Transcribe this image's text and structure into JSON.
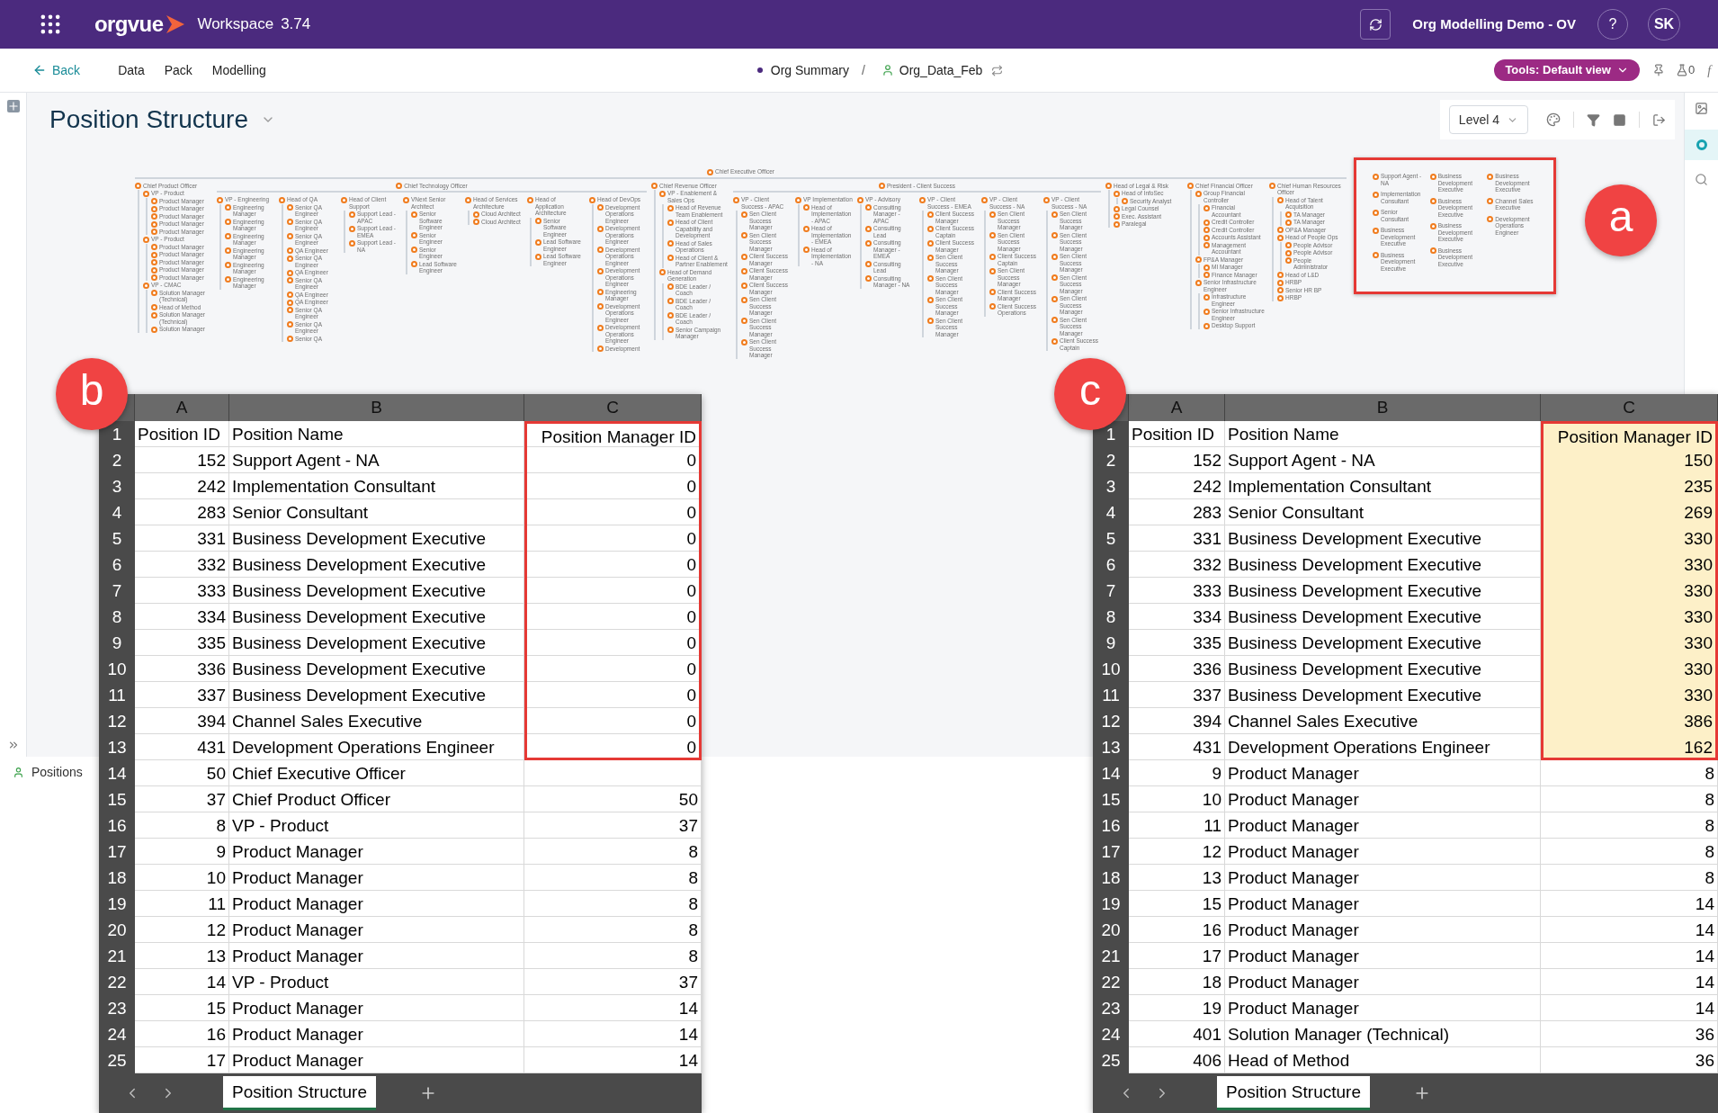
{
  "top_bar": {
    "logo": "orgvue",
    "product": "Workspace",
    "version": "3.74",
    "project": "Org Modelling Demo - OV",
    "help": "?",
    "user_initials": "SK"
  },
  "nav": {
    "back": "Back",
    "menu": [
      "Data",
      "Pack",
      "Modelling"
    ],
    "breadcrumb": [
      "Org Summary",
      "/",
      "Org_Data_Feb"
    ],
    "tools_button": "Tools: Default view",
    "alerts_count": "0",
    "formula": "f"
  },
  "view": {
    "title": "Position Structure",
    "level": "Level 4"
  },
  "chart": {
    "root": {
      "label": "Chief Executive Officer",
      "kind": "row",
      "children": [
        {
          "label": "Chief Product Officer",
          "kind": "stack",
          "children": [
            {
              "label": "VP - Product",
              "kind": "stack",
              "children": [
                {
                  "label": "Product Manager"
                },
                {
                  "label": "Product Manager"
                },
                {
                  "label": "Product Manager"
                },
                {
                  "label": "Product Manager"
                },
                {
                  "label": "Product Manager"
                }
              ]
            },
            {
              "label": "VP - Product",
              "kind": "stack",
              "children": [
                {
                  "label": "Product Manager"
                },
                {
                  "label": "Product Manager"
                },
                {
                  "label": "Product Manager"
                },
                {
                  "label": "Product Manager"
                },
                {
                  "label": "Product Manager"
                }
              ]
            },
            {
              "label": "VP - CMAC",
              "kind": "stack",
              "children": [
                {
                  "label": "Solution Manager (Technical)"
                },
                {
                  "label": "Head of Method"
                },
                {
                  "label": "Solution Manager (Technical)"
                },
                {
                  "label": "Solution Manager"
                }
              ]
            }
          ]
        },
        {
          "label": "Chief Technology Officer",
          "kind": "row",
          "children": [
            {
              "label": "VP - Engineering",
              "kind": "stack",
              "children": [
                {
                  "label": "Engineering Manager"
                },
                {
                  "label": "Engineering Manager"
                },
                {
                  "label": "Engineering Manager"
                },
                {
                  "label": "Engineering Manager"
                },
                {
                  "label": "Engineering Manager"
                },
                {
                  "label": "Engineering Manager"
                }
              ]
            },
            {
              "label": "Head of QA",
              "kind": "stack",
              "children": [
                {
                  "label": "Senior QA Engineer"
                },
                {
                  "label": "Senior QA Engineer"
                },
                {
                  "label": "Senior QA Engineer"
                },
                {
                  "label": "QA Engineer"
                },
                {
                  "label": "Senior QA Engineer"
                },
                {
                  "label": "QA Engineer"
                },
                {
                  "label": "Senior QA Engineer"
                },
                {
                  "label": "QA Engineer"
                },
                {
                  "label": "QA Engineer"
                },
                {
                  "label": "Senior QA Engineer"
                },
                {
                  "label": "Senior QA Engineer"
                },
                {
                  "label": "Senior QA"
                }
              ]
            },
            {
              "label": "Head of Client Support",
              "kind": "stack",
              "children": [
                {
                  "label": "Support Lead - APAC"
                },
                {
                  "label": "Support Lead - EMEA"
                },
                {
                  "label": "Support Lead - NA"
                }
              ]
            },
            {
              "label": "VNext Senior Architect",
              "kind": "stack",
              "children": [
                {
                  "label": "Senior Software Engineer"
                },
                {
                  "label": "Senior Engineer"
                },
                {
                  "label": "Senior Engineer"
                },
                {
                  "label": "Lead Software Engineer"
                }
              ]
            },
            {
              "label": "Head of Services Architecture",
              "kind": "stack",
              "children": [
                {
                  "label": "Cloud Architect"
                },
                {
                  "label": "Cloud Architect"
                }
              ]
            },
            {
              "label": "Head of Application Architecture",
              "kind": "stack",
              "children": [
                {
                  "label": "Senior Software Engineer"
                },
                {
                  "label": "Lead Software Engineer"
                },
                {
                  "label": "Lead Software Engineer"
                }
              ]
            },
            {
              "label": "Head of DevOps",
              "kind": "stack",
              "children": [
                {
                  "label": "Development Operations Engineer"
                },
                {
                  "label": "Development Operations Engineer"
                },
                {
                  "label": "Development Operations Engineer"
                },
                {
                  "label": "Development Operations Engineer"
                },
                {
                  "label": "Engineering Manager"
                },
                {
                  "label": "Development Operations Engineer"
                },
                {
                  "label": "Development Operations Engineer"
                },
                {
                  "label": "Development"
                }
              ]
            }
          ]
        },
        {
          "label": "Chief Revenue Officer",
          "kind": "stack",
          "children": [
            {
              "label": "VP - Enablement & Sales Ops",
              "kind": "stack",
              "children": [
                {
                  "label": "Head of Revenue Team Enablement"
                },
                {
                  "label": "Head of Client Capability and Development"
                },
                {
                  "label": "Head of Sales Operations"
                },
                {
                  "label": "Head of Client & Partner Enablement"
                }
              ]
            },
            {
              "label": "Head of Demand Generation",
              "kind": "stack",
              "children": [
                {
                  "label": "BDE Leader / Coach"
                },
                {
                  "label": "BDE Leader / Coach"
                },
                {
                  "label": "BDE Leader / Coach"
                },
                {
                  "label": "Senior Campaign Manager"
                }
              ]
            }
          ]
        },
        {
          "label": "President - Client Success",
          "kind": "row",
          "children": [
            {
              "label": "VP - Client Success - APAC",
              "kind": "stack",
              "children": [
                {
                  "label": "Sen Client Success Manager"
                },
                {
                  "label": "Sen Client Success Manager"
                },
                {
                  "label": "Client Success Manager"
                },
                {
                  "label": "Client Success Manager"
                },
                {
                  "label": "Client Success Manager"
                },
                {
                  "label": "Sen Client Success Manager"
                },
                {
                  "label": "Sen Client Success Manager"
                },
                {
                  "label": "Sen Client Success Manager"
                }
              ]
            },
            {
              "label": "VP Implementation",
              "kind": "stack",
              "children": [
                {
                  "label": "Head of Implementation - APAC"
                },
                {
                  "label": "Head of Implementation - EMEA"
                },
                {
                  "label": "Head of Implementation - NA"
                }
              ]
            },
            {
              "label": "VP - Advisory",
              "kind": "stack",
              "children": [
                {
                  "label": "Consulting Manager - APAC"
                },
                {
                  "label": "Consulting Lead"
                },
                {
                  "label": "Consulting Manager - EMEA"
                },
                {
                  "label": "Consulting Lead"
                },
                {
                  "label": "Consulting Manager - NA"
                }
              ]
            },
            {
              "label": "VP - Client Success - EMEA",
              "kind": "stack",
              "children": [
                {
                  "label": "Client Success Manager"
                },
                {
                  "label": "Client Success Captain"
                },
                {
                  "label": "Client Success Manager"
                },
                {
                  "label": "Sen Client Success Manager"
                },
                {
                  "label": "Sen Client Success Manager"
                },
                {
                  "label": "Sen Client Success Manager"
                },
                {
                  "label": "Sen Client Success Manager"
                }
              ]
            },
            {
              "label": "VP - Client Success - NA",
              "kind": "stack",
              "children": [
                {
                  "label": "Sen Client Success Manager"
                },
                {
                  "label": "Sen Client Success Manager"
                },
                {
                  "label": "Client Success Captain"
                },
                {
                  "label": "Sen Client Success Manager"
                },
                {
                  "label": "Client Success Manager"
                },
                {
                  "label": "Client Success Operations"
                }
              ]
            },
            {
              "label": "VP - Client Success - NA",
              "kind": "stack",
              "children": [
                {
                  "label": "Sen Client Success Manager"
                },
                {
                  "label": "Sen Client Success Manager"
                },
                {
                  "label": "Sen Client Success Manager"
                },
                {
                  "label": "Sen Client Success Manager"
                },
                {
                  "label": "Sen Client Success Manager"
                },
                {
                  "label": "Sen Client Success Manager"
                },
                {
                  "label": "Client Success Captain"
                }
              ]
            }
          ]
        },
        {
          "label": "Head of Legal & Risk",
          "kind": "stack",
          "children": [
            {
              "label": "Head of InfoSec",
              "kind": "stack",
              "children": [
                {
                  "label": "Security Analyst"
                }
              ]
            },
            {
              "label": "Legal Counsel"
            },
            {
              "label": "Exec. Assistant"
            },
            {
              "label": "Paralegal"
            }
          ]
        },
        {
          "label": "Chief Financial Officer",
          "kind": "stack",
          "children": [
            {
              "label": "Group Financial Controller",
              "kind": "stack",
              "children": [
                {
                  "label": "Financial Accountant"
                },
                {
                  "label": "Credit Controller"
                },
                {
                  "label": "Credit Controller"
                },
                {
                  "label": "Accounts Assistant"
                },
                {
                  "label": "Management Accountant"
                }
              ]
            },
            {
              "label": "FP&A Manager",
              "kind": "stack",
              "children": [
                {
                  "label": "MI Manager"
                },
                {
                  "label": "Finance Manager"
                }
              ]
            },
            {
              "label": "Senior Infrastructure Engineer",
              "kind": "stack",
              "children": [
                {
                  "label": "Infrastructure Engineer"
                },
                {
                  "label": "Senior Infrastructure Engineer"
                },
                {
                  "label": "Desktop Support"
                }
              ]
            }
          ]
        },
        {
          "label": "Chief Human Resources Officer",
          "kind": "stack",
          "children": [
            {
              "label": "Head of Talent Acquisition",
              "kind": "stack",
              "children": [
                {
                  "label": "TA Manager"
                },
                {
                  "label": "TA Manager"
                }
              ]
            },
            {
              "label": "OP&A Manager"
            },
            {
              "label": "Head of People Ops",
              "kind": "stack",
              "children": [
                {
                  "label": "People Advisor"
                },
                {
                  "label": "People Advisor"
                },
                {
                  "label": "People Administrator"
                }
              ]
            },
            {
              "label": "Head of L&D"
            },
            {
              "label": "HRBP"
            },
            {
              "label": "Senior HR BP"
            },
            {
              "label": "HRBP"
            }
          ]
        }
      ]
    },
    "unassigned": [
      [
        "Support Agent - NA",
        "Implementation Consultant",
        "Senior Consultant",
        "Business Development Executive",
        "Business Development Executive"
      ],
      [
        "Business Development Executive",
        "Business Development Executive",
        "Business Development Executive",
        "Business Development Executive"
      ],
      [
        "Business Development Executive",
        "Channel Sales Executive",
        "Development Operations Engineer"
      ]
    ]
  },
  "side_panel": {
    "label": "Positions"
  },
  "annotations": [
    {
      "label": "a"
    },
    {
      "label": "b"
    },
    {
      "label": "c"
    }
  ],
  "sheets": [
    {
      "shaded": false,
      "columns": [
        "A",
        "B",
        "C"
      ],
      "tab": "Position Structure",
      "rows": [
        {
          "number": "1",
          "cells": [
            "Position ID",
            "Position Name",
            "Position Manager ID"
          ],
          "highlighted": true
        },
        {
          "number": "2",
          "cells": [
            "152",
            "Support Agent - NA",
            "0"
          ],
          "highlighted": true
        },
        {
          "number": "3",
          "cells": [
            "242",
            "Implementation Consultant",
            "0"
          ],
          "highlighted": true
        },
        {
          "number": "4",
          "cells": [
            "283",
            "Senior Consultant",
            "0"
          ],
          "highlighted": true
        },
        {
          "number": "5",
          "cells": [
            "331",
            "Business Development Executive",
            "0"
          ],
          "highlighted": true
        },
        {
          "number": "6",
          "cells": [
            "332",
            "Business Development Executive",
            "0"
          ],
          "highlighted": true
        },
        {
          "number": "7",
          "cells": [
            "333",
            "Business Development Executive",
            "0"
          ],
          "highlighted": true
        },
        {
          "number": "8",
          "cells": [
            "334",
            "Business Development Executive",
            "0"
          ],
          "highlighted": true
        },
        {
          "number": "9",
          "cells": [
            "335",
            "Business Development Executive",
            "0"
          ],
          "highlighted": true
        },
        {
          "number": "10",
          "cells": [
            "336",
            "Business Development Executive",
            "0"
          ],
          "highlighted": true
        },
        {
          "number": "11",
          "cells": [
            "337",
            "Business Development Executive",
            "0"
          ],
          "highlighted": true
        },
        {
          "number": "12",
          "cells": [
            "394",
            "Channel Sales Executive",
            "0"
          ],
          "highlighted": true
        },
        {
          "number": "13",
          "cells": [
            "431",
            "Development Operations Engineer",
            "0"
          ],
          "highlighted": true
        },
        {
          "number": "14",
          "cells": [
            "50",
            "Chief Executive Officer"
          ],
          "highlighted": false
        },
        {
          "number": "15",
          "cells": [
            "37",
            "Chief Product Officer",
            "50"
          ],
          "highlighted": false
        },
        {
          "number": "16",
          "cells": [
            "8",
            "VP - Product",
            "37"
          ],
          "highlighted": false
        },
        {
          "number": "17",
          "cells": [
            "9",
            "Product Manager",
            "8"
          ],
          "highlighted": false
        },
        {
          "number": "18",
          "cells": [
            "10",
            "Product Manager",
            "8"
          ],
          "highlighted": false
        },
        {
          "number": "19",
          "cells": [
            "11",
            "Product Manager",
            "8"
          ],
          "highlighted": false
        },
        {
          "number": "20",
          "cells": [
            "12",
            "Product Manager",
            "8"
          ],
          "highlighted": false
        },
        {
          "number": "21",
          "cells": [
            "13",
            "Product Manager",
            "8"
          ],
          "highlighted": false
        },
        {
          "number": "22",
          "cells": [
            "14",
            "VP - Product",
            "37"
          ],
          "highlighted": false
        },
        {
          "number": "23",
          "cells": [
            "15",
            "Product Manager",
            "14"
          ],
          "highlighted": false
        },
        {
          "number": "24",
          "cells": [
            "16",
            "Product Manager",
            "14"
          ],
          "highlighted": false
        },
        {
          "number": "25",
          "cells": [
            "17",
            "Product Manager",
            "14"
          ],
          "highlighted": false
        }
      ]
    },
    {
      "shaded": true,
      "columns": [
        "A",
        "B",
        "C"
      ],
      "tab": "Position Structure",
      "rows": [
        {
          "number": "1",
          "cells": [
            "Position ID",
            "Position Name",
            "Position Manager ID"
          ],
          "highlighted": true
        },
        {
          "number": "2",
          "cells": [
            "152",
            "Support Agent - NA",
            "150"
          ],
          "highlighted": true
        },
        {
          "number": "3",
          "cells": [
            "242",
            "Implementation Consultant",
            "235"
          ],
          "highlighted": true
        },
        {
          "number": "4",
          "cells": [
            "283",
            "Senior Consultant",
            "269"
          ],
          "highlighted": true
        },
        {
          "number": "5",
          "cells": [
            "331",
            "Business Development Executive",
            "330"
          ],
          "highlighted": true
        },
        {
          "number": "6",
          "cells": [
            "332",
            "Business Development Executive",
            "330"
          ],
          "highlighted": true
        },
        {
          "number": "7",
          "cells": [
            "333",
            "Business Development Executive",
            "330"
          ],
          "highlighted": true
        },
        {
          "number": "8",
          "cells": [
            "334",
            "Business Development Executive",
            "330"
          ],
          "highlighted": true
        },
        {
          "number": "9",
          "cells": [
            "335",
            "Business Development Executive",
            "330"
          ],
          "highlighted": true
        },
        {
          "number": "10",
          "cells": [
            "336",
            "Business Development Executive",
            "330"
          ],
          "highlighted": true
        },
        {
          "number": "11",
          "cells": [
            "337",
            "Business Development Executive",
            "330"
          ],
          "highlighted": true
        },
        {
          "number": "12",
          "cells": [
            "394",
            "Channel Sales Executive",
            "386"
          ],
          "highlighted": true
        },
        {
          "number": "13",
          "cells": [
            "431",
            "Development Operations Engineer",
            "162"
          ],
          "highlighted": true
        },
        {
          "number": "14",
          "cells": [
            "9",
            "Product Manager",
            "8"
          ],
          "highlighted": false
        },
        {
          "number": "15",
          "cells": [
            "10",
            "Product Manager",
            "8"
          ],
          "highlighted": false
        },
        {
          "number": "16",
          "cells": [
            "11",
            "Product Manager",
            "8"
          ],
          "highlighted": false
        },
        {
          "number": "17",
          "cells": [
            "12",
            "Product Manager",
            "8"
          ],
          "highlighted": false
        },
        {
          "number": "18",
          "cells": [
            "13",
            "Product Manager",
            "8"
          ],
          "highlighted": false
        },
        {
          "number": "19",
          "cells": [
            "15",
            "Product Manager",
            "14"
          ],
          "highlighted": false
        },
        {
          "number": "20",
          "cells": [
            "16",
            "Product Manager",
            "14"
          ],
          "highlighted": false
        },
        {
          "number": "21",
          "cells": [
            "17",
            "Product Manager",
            "14"
          ],
          "highlighted": false
        },
        {
          "number": "22",
          "cells": [
            "18",
            "Product Manager",
            "14"
          ],
          "highlighted": false
        },
        {
          "number": "23",
          "cells": [
            "19",
            "Product Manager",
            "14"
          ],
          "highlighted": false
        },
        {
          "number": "24",
          "cells": [
            "401",
            "Solution Manager (Technical)",
            "36"
          ],
          "highlighted": false
        },
        {
          "number": "25",
          "cells": [
            "406",
            "Head of Method",
            "36"
          ],
          "highlighted": false
        }
      ]
    }
  ]
}
